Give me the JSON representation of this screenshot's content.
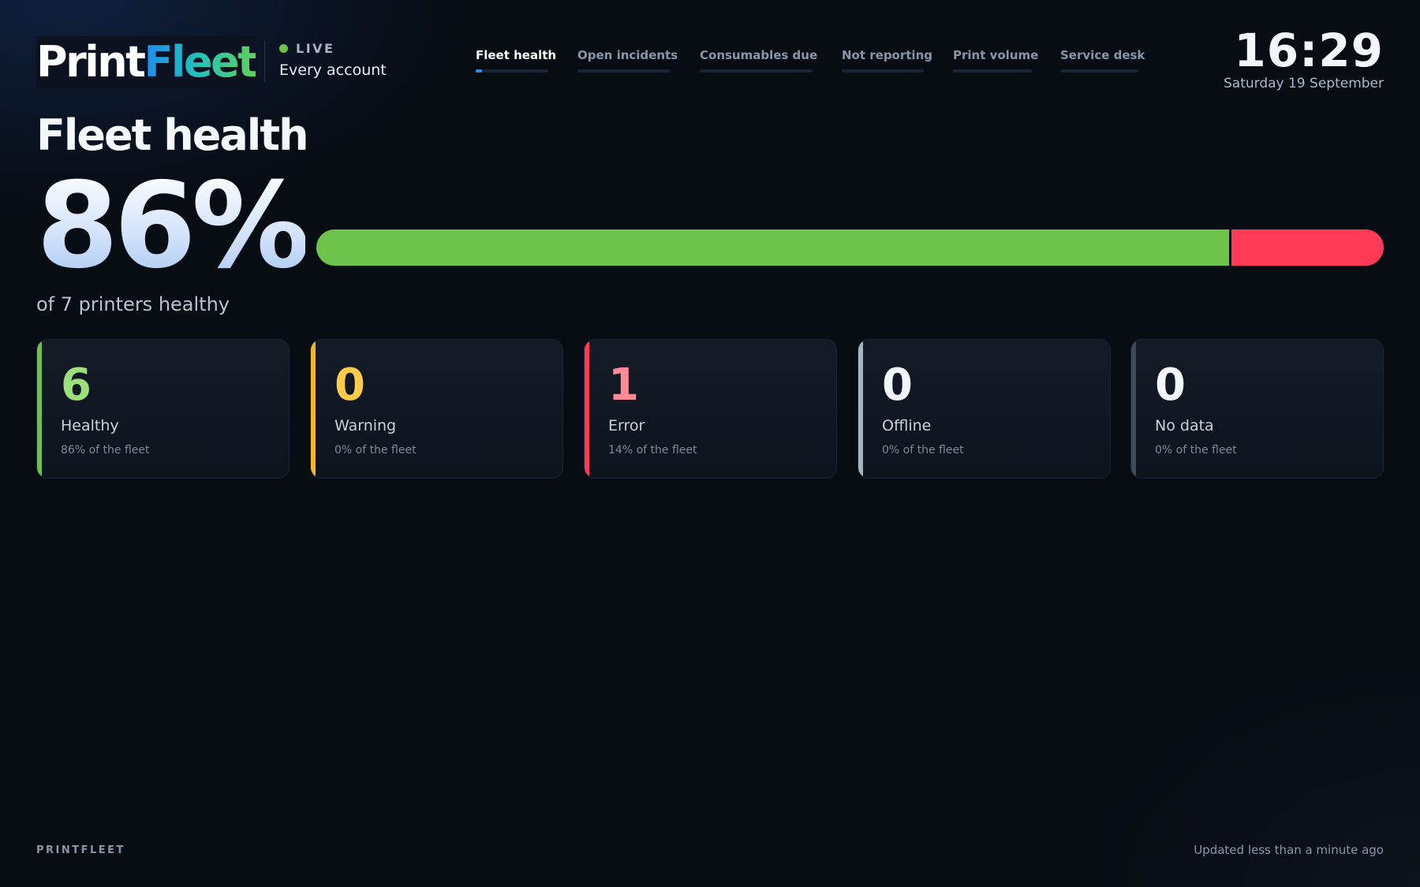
{
  "header": {
    "logo": {
      "part1": "Print",
      "part2": "Fleet"
    },
    "live_label": "LIVE",
    "account": "Every account",
    "clock": "16:29",
    "date": "Saturday 19 September"
  },
  "tabs": [
    {
      "label": "Fleet health",
      "active": true,
      "progress": 0.09
    },
    {
      "label": "Open incidents",
      "active": false,
      "progress": 0
    },
    {
      "label": "Consumables due",
      "active": false,
      "progress": 0
    },
    {
      "label": "Not reporting",
      "active": false,
      "progress": 0
    },
    {
      "label": "Print volume",
      "active": false,
      "progress": 0
    },
    {
      "label": "Service desk",
      "active": false,
      "progress": 0
    }
  ],
  "hero": {
    "title": "Fleet health",
    "percent": "86%",
    "subline": "of 7 printers healthy"
  },
  "health_bar": [
    {
      "name": "healthy",
      "fraction": 0.857,
      "color": "#6cc24a"
    },
    {
      "name": "error",
      "fraction": 0.143,
      "color": "#ff3a57"
    }
  ],
  "cards": [
    {
      "value": "6",
      "label": "Healthy",
      "sub": "86% of the fleet",
      "accent": "#6cc24a",
      "value_color": "#9be07a"
    },
    {
      "value": "0",
      "label": "Warning",
      "sub": "0% of the fleet",
      "accent": "#f5b52a",
      "value_color": "#ffcb4a"
    },
    {
      "value": "1",
      "label": "Error",
      "sub": "14% of the fleet",
      "accent": "#ff3a57",
      "value_color": "#ff8a98"
    },
    {
      "value": "0",
      "label": "Offline",
      "sub": "0% of the fleet",
      "accent": "#a9b4c2",
      "value_color": "#f2f5f9"
    },
    {
      "value": "0",
      "label": "No data",
      "sub": "0% of the fleet",
      "accent": "#3f4a5a",
      "value_color": "#f2f5f9"
    }
  ],
  "footer": {
    "brand": "PRINTFLEET",
    "updated": "Updated less than a minute ago"
  }
}
